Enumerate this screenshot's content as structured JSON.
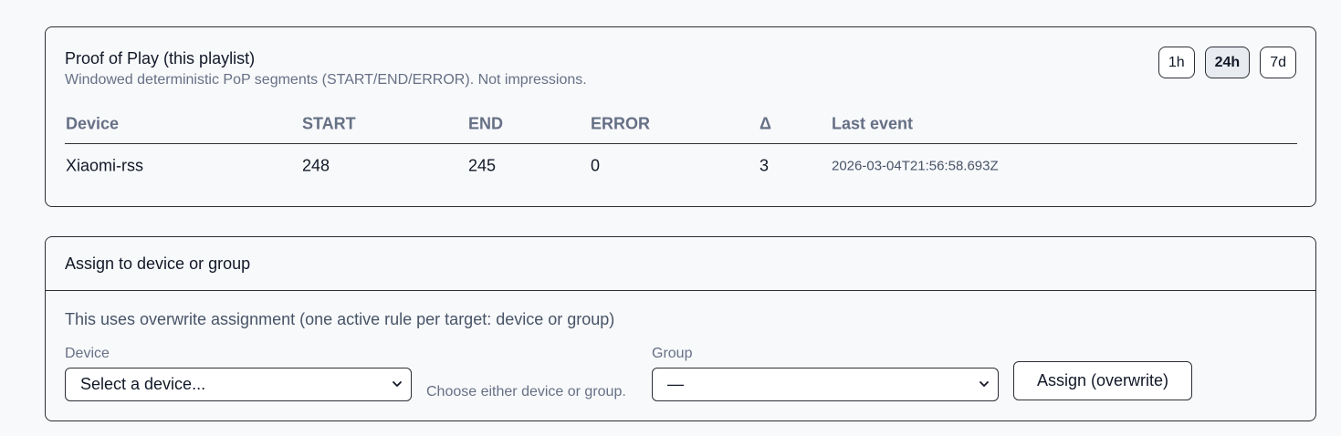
{
  "pop": {
    "title": "Proof of Play (this playlist)",
    "subtitle": "Windowed deterministic PoP segments (START/END/ERROR). Not impressions.",
    "ranges": [
      {
        "label": "1h",
        "active": false
      },
      {
        "label": "24h",
        "active": true
      },
      {
        "label": "7d",
        "active": false
      }
    ],
    "columns": [
      "Device",
      "START",
      "END",
      "ERROR",
      "Δ",
      "Last event"
    ],
    "rows": [
      {
        "device": "Xiaomi-rss",
        "start": "248",
        "end": "245",
        "error": "0",
        "delta": "3",
        "last_event": "2026-03-04T21:56:58.693Z"
      }
    ]
  },
  "assign": {
    "title": "Assign to device or group",
    "description": "This uses overwrite assignment (one active rule per target: device or group)",
    "device_label": "Device",
    "device_selected": "Select a device...",
    "hint": "Choose either device or group.",
    "group_label": "Group",
    "group_selected": "—",
    "button_label": "Assign (overwrite)"
  }
}
